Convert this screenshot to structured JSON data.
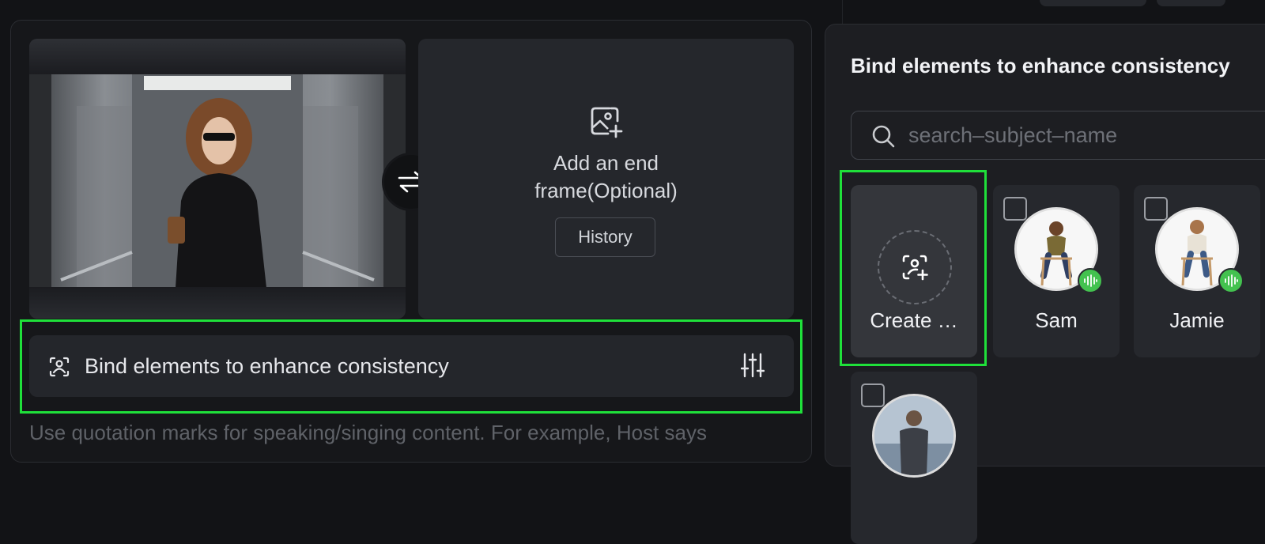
{
  "start_frame": {
    "image_name": "woman-in-elevator-photo"
  },
  "end_frame": {
    "title_line1": "Add an end",
    "title_line2": "frame(Optional)",
    "history_label": "History"
  },
  "bind_bar": {
    "label": "Bind elements to enhance consistency"
  },
  "hint_text": "Use quotation marks for speaking/singing content. For example, Host says",
  "side_panel": {
    "title": "Bind elements to enhance consistency",
    "search_placeholder": "search–subject–name",
    "cards": [
      {
        "name": "Create …",
        "type": "create"
      },
      {
        "name": "Sam",
        "type": "subject",
        "checked": false,
        "voice": true
      },
      {
        "name": "Jamie",
        "type": "subject",
        "checked": false,
        "voice": true
      },
      {
        "name": "",
        "type": "subject",
        "checked": false,
        "voice": false
      }
    ]
  },
  "colors": {
    "accent_highlight": "#1fe03a",
    "voice_badge": "#43c24f",
    "panel_bg": "#16171a",
    "card_bg": "#26282d"
  },
  "icons": {
    "end_frame": "image-add-icon",
    "swap": "swap-arrows-icon",
    "bind": "subject-bind-icon",
    "adjust": "sliders-icon",
    "search": "search-icon",
    "create": "subject-add-icon",
    "voice": "voice-wave-icon"
  }
}
